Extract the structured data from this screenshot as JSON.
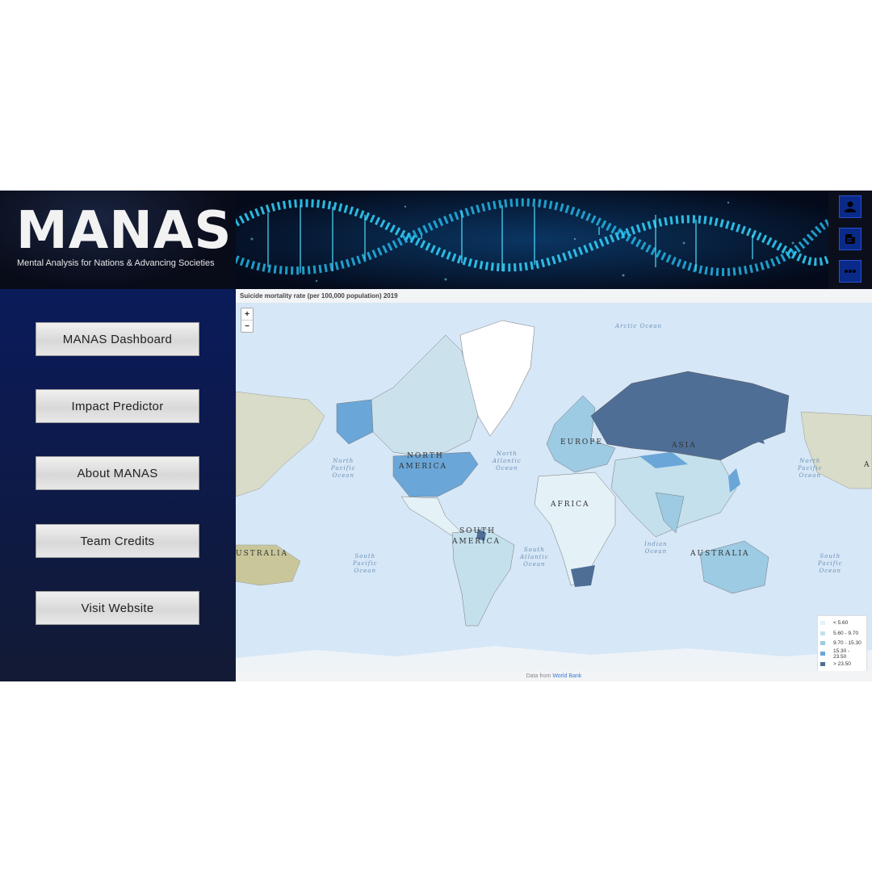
{
  "app": {
    "title": "MANAS",
    "subtitle": "Mental Analysis for Nations & Advancing Societies"
  },
  "header_icons": [
    "user-icon",
    "notes-icon",
    "more-icon"
  ],
  "sidebar": {
    "items": [
      {
        "label": "MANAS Dashboard"
      },
      {
        "label": "Impact Predictor"
      },
      {
        "label": "About MANAS"
      },
      {
        "label": "Team Credits"
      },
      {
        "label": "Visit Website"
      }
    ]
  },
  "map": {
    "title": "Suicide mortality rate (per 100,000 population) 2019",
    "zoom_in": "+",
    "zoom_out": "−",
    "oceans": {
      "arctic": "Arctic Ocean",
      "north_pacific_left": "North\nPacific\nOcean",
      "north_atlantic": "North\nAtlantic\nOcean",
      "north_pacific_right": "North\nPacific\nOcean",
      "south_pacific_left": "South\nPacific\nOcean",
      "south_atlantic": "South\nAtlantic\nOcean",
      "indian": "Indian\nOcean",
      "south_pacific_right": "South\nPacific\nOcean"
    },
    "continents": {
      "north_america_1": "NORTH",
      "north_america_2": "AMERICA",
      "south_america_1": "SOUTH",
      "south_america_2": "AMERICA",
      "europe": "EUROPE",
      "africa": "AFRICA",
      "asia": "ASIA",
      "australia": "AUSTRALIA",
      "australia_left": "USTRALIA",
      "asia_edge": "A"
    },
    "legend": [
      {
        "label": "< 5.60",
        "color": "#e4f1f7"
      },
      {
        "label": "5.60 - 9.70",
        "color": "#c4e0ec"
      },
      {
        "label": "9.70 - 15.30",
        "color": "#9ccbe3"
      },
      {
        "label": "15.30 - 23.50",
        "color": "#6aa6d8"
      },
      {
        "label": "> 23.50",
        "color": "#4e6e96"
      }
    ],
    "credit_prefix": "Data from ",
    "credit_link": "World Bank"
  }
}
